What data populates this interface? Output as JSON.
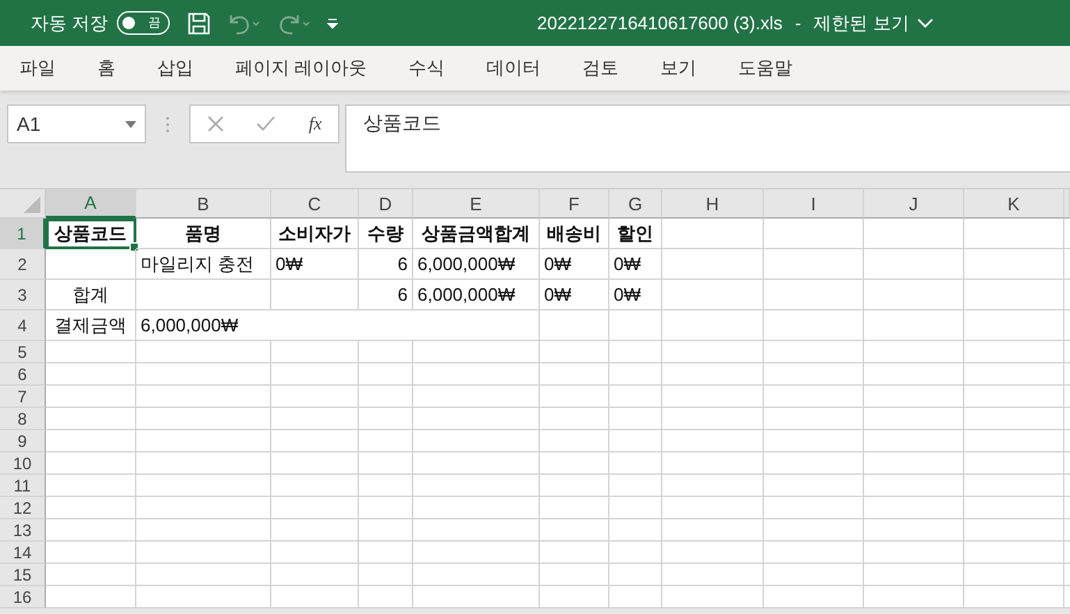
{
  "title_bar": {
    "autosave_label": "자동 저장",
    "autosave_toggle": {
      "text": "끔",
      "on": false
    },
    "filename": "2022122716410617600 (3).xls",
    "separator": "-",
    "mode": "제한된 보기"
  },
  "menu": [
    "파일",
    "홈",
    "삽입",
    "페이지 레이아웃",
    "수식",
    "데이터",
    "검토",
    "보기",
    "도움말"
  ],
  "formula_bar": {
    "name_box": "A1",
    "fx": "fx",
    "value": "상품코드"
  },
  "sheet": {
    "columns": [
      {
        "letter": "A",
        "selected": true
      },
      {
        "letter": "B",
        "selected": false
      },
      {
        "letter": "C",
        "selected": false
      },
      {
        "letter": "D",
        "selected": false
      },
      {
        "letter": "E",
        "selected": false
      },
      {
        "letter": "F",
        "selected": false
      },
      {
        "letter": "G",
        "selected": false
      },
      {
        "letter": "H",
        "selected": false
      },
      {
        "letter": "I",
        "selected": false
      },
      {
        "letter": "J",
        "selected": false
      },
      {
        "letter": "K",
        "selected": false
      }
    ],
    "rows": [
      {
        "label": "1",
        "selected": true,
        "cells": [
          {
            "text": "상품코드",
            "kind": "header",
            "selected": true
          },
          {
            "text": "품명",
            "kind": "header",
            "selected": false
          },
          {
            "text": "소비자가",
            "kind": "header",
            "selected": false
          },
          {
            "text": "수량",
            "kind": "header",
            "selected": false
          },
          {
            "text": "상품금액합계",
            "kind": "header",
            "selected": false
          },
          {
            "text": "배송비",
            "kind": "header",
            "selected": false
          },
          {
            "text": "할인",
            "kind": "header",
            "selected": false
          }
        ]
      },
      {
        "label": "2",
        "selected": false,
        "cells": [
          null,
          {
            "text": "마일리지 충전",
            "kind": "text",
            "selected": false
          },
          {
            "text": "0₩",
            "kind": "text",
            "selected": false
          },
          {
            "text": "6",
            "kind": "number",
            "selected": false
          },
          {
            "text": "6,000,000₩",
            "kind": "text",
            "selected": false
          },
          {
            "text": "0₩",
            "kind": "text",
            "selected": false
          },
          {
            "text": "0₩",
            "kind": "text",
            "selected": false
          }
        ]
      },
      {
        "label": "3",
        "selected": false,
        "cells": [
          {
            "text": "합계",
            "kind": "label",
            "selected": false
          },
          null,
          null,
          {
            "text": "6",
            "kind": "number",
            "selected": false
          },
          {
            "text": "6,000,000₩",
            "kind": "text",
            "selected": false
          },
          {
            "text": "0₩",
            "kind": "text",
            "selected": false
          },
          {
            "text": "0₩",
            "kind": "text",
            "selected": false
          }
        ]
      },
      {
        "label": "4",
        "selected": false,
        "cells": [
          {
            "text": "결제금액",
            "kind": "label",
            "selected": false
          },
          {
            "text": "6,000,000₩",
            "kind": "spill",
            "selected": false
          },
          null,
          null,
          null
        ]
      },
      {
        "label": "5",
        "selected": false,
        "cells": []
      },
      {
        "label": "6",
        "selected": false,
        "cells": []
      },
      {
        "label": "7",
        "selected": false,
        "cells": []
      },
      {
        "label": "8",
        "selected": false,
        "cells": []
      },
      {
        "label": "9",
        "selected": false,
        "cells": []
      },
      {
        "label": "10",
        "selected": false,
        "cells": []
      },
      {
        "label": "11",
        "selected": false,
        "cells": []
      },
      {
        "label": "12",
        "selected": false,
        "cells": []
      },
      {
        "label": "13",
        "selected": false,
        "cells": []
      },
      {
        "label": "14",
        "selected": false,
        "cells": []
      },
      {
        "label": "15",
        "selected": false,
        "cells": []
      },
      {
        "label": "16",
        "selected": false,
        "cells": []
      }
    ]
  }
}
